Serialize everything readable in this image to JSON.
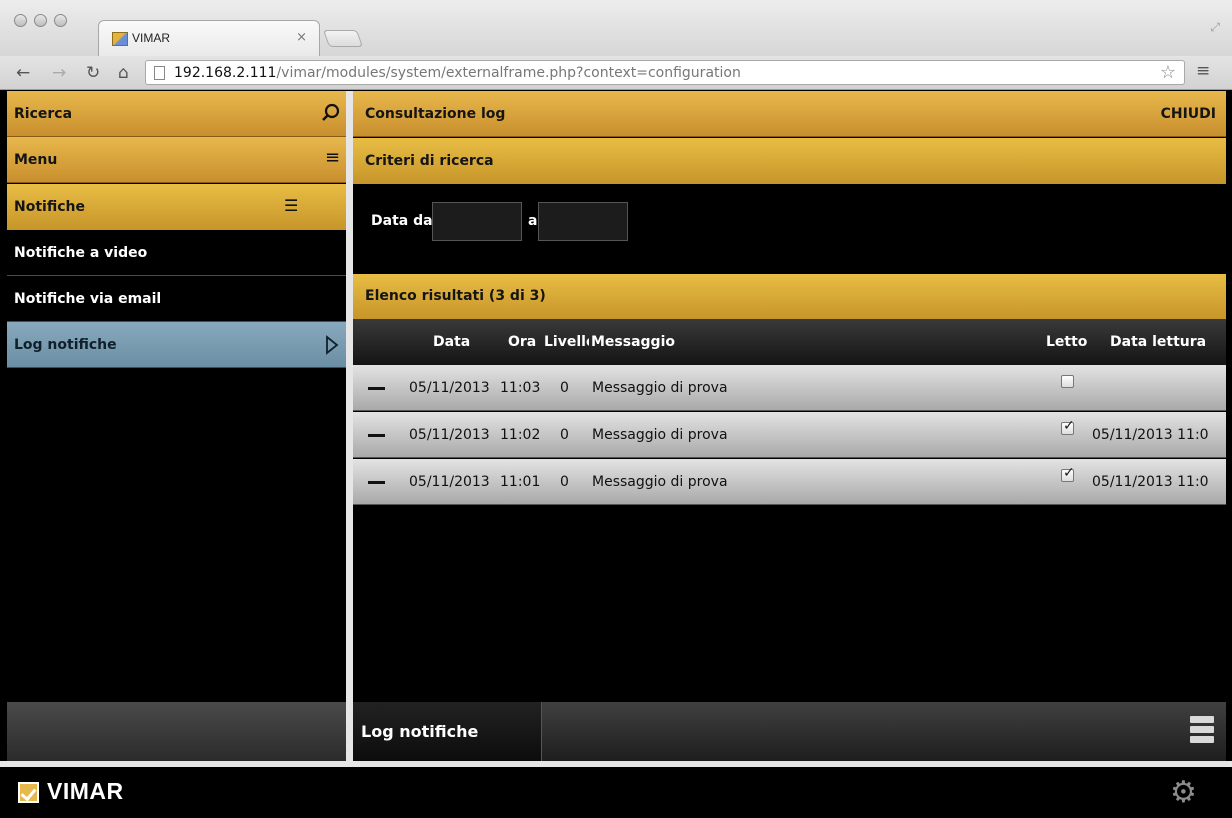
{
  "browser": {
    "tab_title": "VIMAR",
    "tab_close": "×",
    "url_host": "192.168.2.111",
    "url_path": "/vimar/modules/system/externalframe.php?context=configuration"
  },
  "sidebar": {
    "search_label": "Ricerca",
    "menu_label": "Menu",
    "section_label": "Notifiche",
    "items": [
      {
        "label": "Notifiche a video"
      },
      {
        "label": "Notifiche via email"
      },
      {
        "label": "Log notifiche"
      }
    ]
  },
  "main": {
    "title": "Consultazione log",
    "close_label": "CHIUDI",
    "criteria_title": "Criteri di ricerca",
    "date_from_label": "Data da",
    "date_to_label": "a",
    "results_title": "Elenco risultati (3 di 3)",
    "columns": {
      "date": "Data",
      "time": "Ora",
      "level": "Livello",
      "message": "Messaggio",
      "read": "Letto",
      "read_date": "Data lettura"
    },
    "rows": [
      {
        "date": "05/11/2013",
        "time": "11:03",
        "level": "0",
        "message": "Messaggio di prova",
        "read": false,
        "read_date": ""
      },
      {
        "date": "05/11/2013",
        "time": "11:02",
        "level": "0",
        "message": "Messaggio di prova",
        "read": true,
        "read_date": "05/11/2013 11:0"
      },
      {
        "date": "05/11/2013",
        "time": "11:01",
        "level": "0",
        "message": "Messaggio di prova",
        "read": true,
        "read_date": "05/11/2013 11:0"
      }
    ],
    "footer_tab": "Log notifiche"
  },
  "brand": {
    "name": "VIMAR"
  },
  "icons": {
    "search": "search-icon",
    "menu": "menu-icon",
    "notifications": "notifications-icon",
    "arrow": "chevron-right-icon",
    "gear": "gear-icon",
    "list": "list-icon"
  }
}
